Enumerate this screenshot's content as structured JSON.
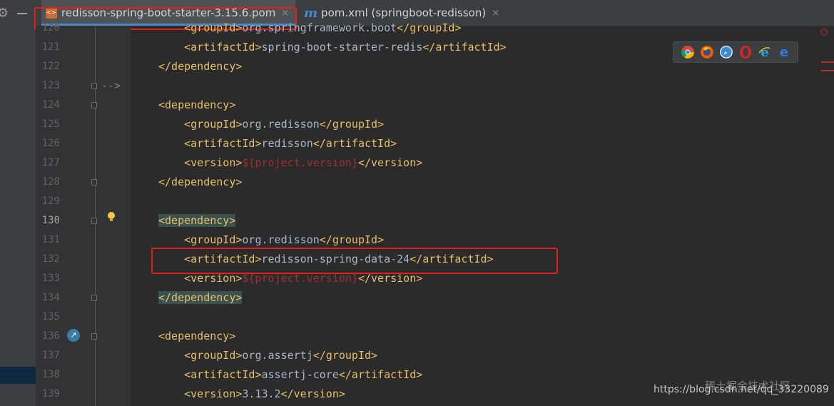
{
  "tabs": [
    {
      "label": "redisson-spring-boot-starter-3.15.6.pom",
      "active": true,
      "close": "×"
    },
    {
      "icon_text": "m",
      "label": "pom.xml (springboot-redisson)",
      "active": false,
      "close": "×"
    }
  ],
  "gutter": {
    "lines": [
      "120",
      "121",
      "122",
      "123",
      "124",
      "125",
      "126",
      "127",
      "128",
      "129",
      "130",
      "131",
      "132",
      "133",
      "134",
      "135",
      "136",
      "137",
      "138",
      "139"
    ],
    "current_line": "130"
  },
  "code": {
    "l120": {
      "open": "<groupId>",
      "text": "org.springframework.boot",
      "close": "</groupId>"
    },
    "l121": {
      "open": "<artifactId>",
      "text": "spring-boot-starter-redis",
      "close": "</artifactId>"
    },
    "l122": "</dependency>",
    "l123": "-->",
    "l124": "<dependency>",
    "l125": {
      "open": "<groupId>",
      "text": "org.redisson",
      "close": "</groupId>"
    },
    "l126": {
      "open": "<artifactId>",
      "text": "redisson",
      "close": "</artifactId>"
    },
    "l127": {
      "open": "<version>",
      "text": "${project.version}",
      "close": "</version>"
    },
    "l128": "</dependency>",
    "l130": "<dependency>",
    "l131": {
      "open": "<groupId>",
      "text": "org.redisson",
      "close": "</groupId>"
    },
    "l132": {
      "open": "<artifactId>",
      "text": "redisson-spring-data-24",
      "close": "</artifactId>"
    },
    "l133": {
      "open": "<version>",
      "text": "${project.version}",
      "close": "</version>"
    },
    "l134": "</dependency>",
    "l136": "<dependency>",
    "l137": {
      "open": "<groupId>",
      "text": "org.assertj",
      "close": "</groupId>"
    },
    "l138": {
      "open": "<artifactId>",
      "text": "assertj-core",
      "close": "</artifactId>"
    },
    "l139": {
      "open": "<version>",
      "text": "3.13.2",
      "close": "</version>"
    }
  },
  "browsers": [
    "chrome-icon",
    "firefox-icon",
    "safari-icon",
    "opera-icon",
    "ie-icon",
    "edge-icon"
  ],
  "colors": {
    "tag": "#e8bf6a",
    "text": "#a9b7c6",
    "variable": "#9e2f2f",
    "highlight_box": "#e02020",
    "brace_match": "#3b514d"
  },
  "watermark": {
    "site": "稀土掘金技术社区",
    "url": "https://blog.csdn.net/qq_33220089"
  }
}
